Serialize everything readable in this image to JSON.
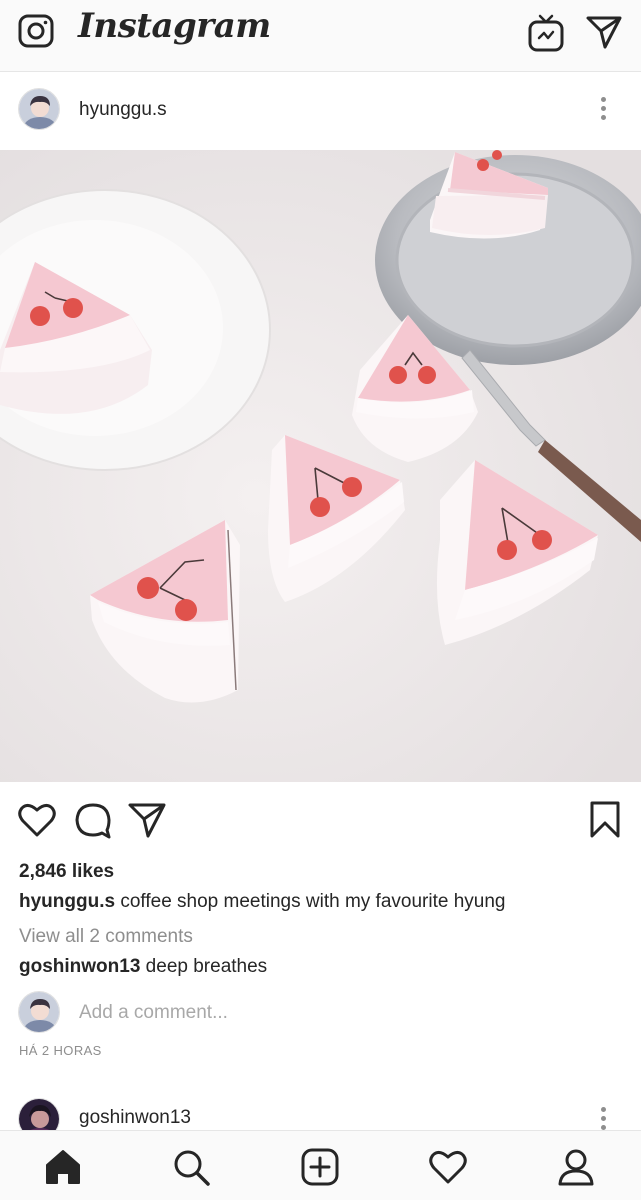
{
  "app": {
    "logo_text": "Instagram"
  },
  "post": {
    "username": "hyunggu.s",
    "likes": "2,846 likes",
    "caption_user": "hyunggu.s",
    "caption_text": " coffee shop meetings with my favourite hyung",
    "view_comments": "View all 2 comments",
    "comment_user": "goshinwon13",
    "comment_text": " deep breathes",
    "add_comment_placeholder": "Add a comment...",
    "timestamp": "HÁ 2 HORAS"
  },
  "next_post": {
    "username": "goshinwon13"
  },
  "icons": {
    "top": [
      "camera-icon",
      "igtv-icon",
      "direct-message-icon"
    ],
    "actions": [
      "heart-icon",
      "comment-icon",
      "share-icon",
      "bookmark-icon"
    ],
    "bottom_nav": [
      "home-icon",
      "search-icon",
      "new-post-icon",
      "activity-heart-icon",
      "profile-icon"
    ]
  },
  "colors": {
    "text": "#262626",
    "secondary": "#8e8e8e",
    "background": "#ffffff",
    "cake_pink": "#f6cfd6",
    "cherry": "#e0524c"
  }
}
